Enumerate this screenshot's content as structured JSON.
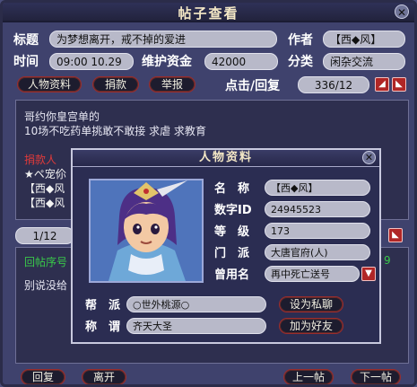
{
  "window": {
    "title": "帖子查看"
  },
  "header": {
    "title_label": "标题",
    "title_value": "为梦想离开，戒不掉的爱进",
    "author_label": "作者",
    "author_value": "【西◆风】",
    "time_label": "时间",
    "time_value": "09:00 10.29",
    "fund_label": "维护资金",
    "fund_value": "42000",
    "category_label": "分类",
    "category_value": "闲杂交流"
  },
  "toolbar": {
    "profile_btn": "人物资料",
    "donate_btn": "捐款",
    "report_btn": "举报",
    "stats_label": "点击/回复",
    "stats_value": "336/12"
  },
  "post": {
    "line1": "哥约你皇宫单的",
    "line2": "10场不吃药单挑敢不敢接 求虐 求教育"
  },
  "donors": {
    "heading": "捐款人",
    "line1": "★ペ宠伱",
    "line2": "【西◆风",
    "line3": "【西◆风"
  },
  "reply": {
    "page": "1/12",
    "floor_label": "回帖序号",
    "floor_right": "9",
    "body": "别说没给"
  },
  "footer": {
    "reply_btn": "回复",
    "leave_btn": "离开",
    "prev_btn": "上一帖",
    "next_btn": "下一帖"
  },
  "profile": {
    "title": "人物资料",
    "name_label": "名　称",
    "name_value": "【西◆风】",
    "id_label": "数字ID",
    "id_value": "24945523",
    "level_label": "等　级",
    "level_value": "173",
    "school_label": "门　派",
    "school_value": "大唐官府(人)",
    "former_label": "曾用名",
    "former_value": "再中死亡送号",
    "gang_label": "帮　派",
    "gang_value": "○世外桃源○",
    "title2_label": "称　谓",
    "title2_value": "齐天大圣",
    "private_btn": "设为私聊",
    "friend_btn": "加为好友"
  }
}
